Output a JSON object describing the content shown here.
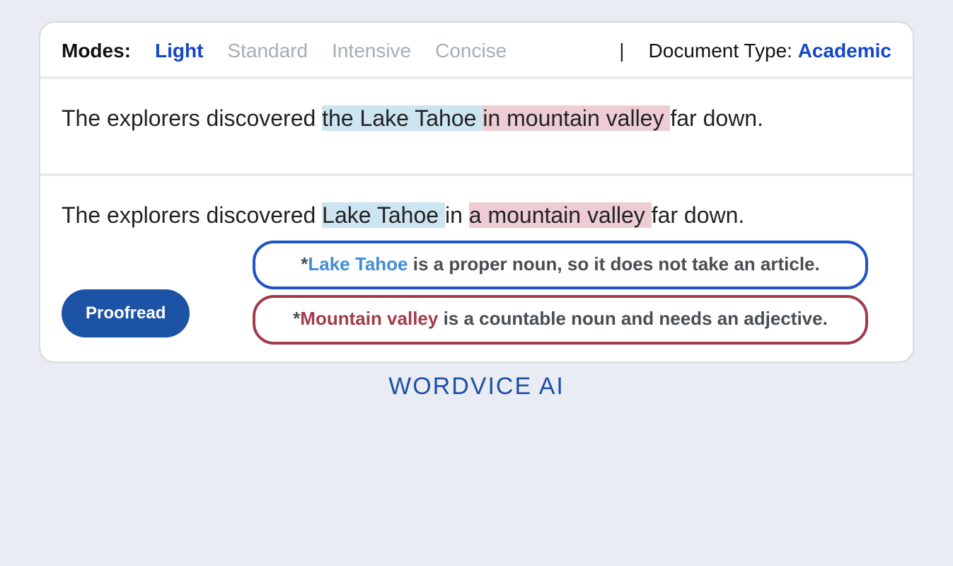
{
  "modes": {
    "label": "Modes:",
    "options": [
      "Light",
      "Standard",
      "Intensive",
      "Concise"
    ],
    "active": "Light"
  },
  "doc_type": {
    "label": "Document Type: ",
    "value": "Academic"
  },
  "original": {
    "prefix": "The explorers discovered ",
    "hl_blue": "the Lake Tahoe ",
    "hl_pink": "in mountain valley ",
    "suffix": "far down."
  },
  "corrected": {
    "prefix": "The explorers discovered ",
    "hl_blue": "Lake Tahoe ",
    "mid": "in ",
    "hl_pink": "a mountain valley ",
    "suffix": "far down."
  },
  "callouts": {
    "blue": {
      "star": "*",
      "term": "Lake Tahoe",
      "rest": " is a proper noun, so it does not take an article."
    },
    "red": {
      "star": "*",
      "term": "Mountain valley",
      "rest": " is a countable noun and needs an adjective."
    }
  },
  "proofread_label": "Proofread",
  "brand": "WORDVICE AI"
}
